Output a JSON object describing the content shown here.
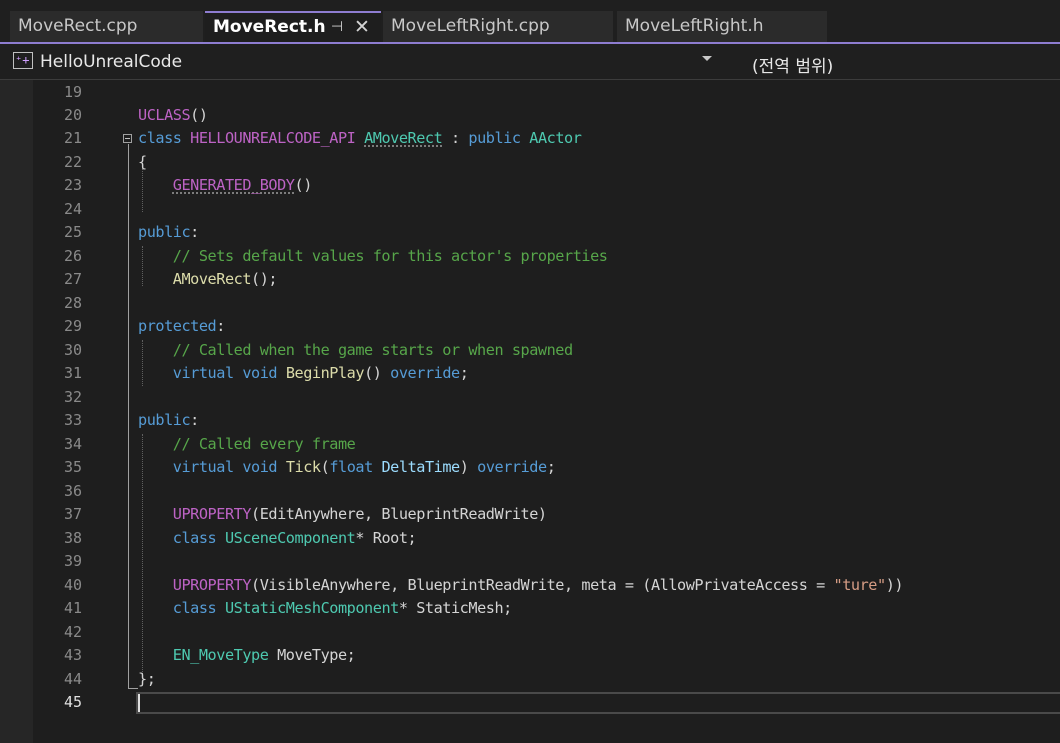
{
  "tabs": [
    {
      "label": "MoveRect.cpp",
      "active": false
    },
    {
      "label": "MoveRect.h",
      "active": true,
      "pin_icon": "pin-icon",
      "close_icon": "close-icon"
    },
    {
      "label": "MoveLeftRight.cpp",
      "active": false
    },
    {
      "label": "MoveLeftRight.h",
      "active": false
    }
  ],
  "navbar": {
    "project": "HelloUnrealCode",
    "project_icon": "cpp-project-icon",
    "scope": "(전역 범위)"
  },
  "editor": {
    "current_line": 45,
    "lines": [
      {
        "n": 19,
        "text": ""
      },
      {
        "n": 20,
        "text": "UCLASS()"
      },
      {
        "n": 21,
        "text": "class HELLOUNREALCODE_API AMoveRect : public AActor"
      },
      {
        "n": 22,
        "text": "{"
      },
      {
        "n": 23,
        "text": "    GENERATED_BODY()"
      },
      {
        "n": 24,
        "text": ""
      },
      {
        "n": 25,
        "text": "public:"
      },
      {
        "n": 26,
        "text": "    // Sets default values for this actor's properties"
      },
      {
        "n": 27,
        "text": "    AMoveRect();"
      },
      {
        "n": 28,
        "text": ""
      },
      {
        "n": 29,
        "text": "protected:"
      },
      {
        "n": 30,
        "text": "    // Called when the game starts or when spawned"
      },
      {
        "n": 31,
        "text": "    virtual void BeginPlay() override;"
      },
      {
        "n": 32,
        "text": ""
      },
      {
        "n": 33,
        "text": "public:"
      },
      {
        "n": 34,
        "text": "    // Called every frame"
      },
      {
        "n": 35,
        "text": "    virtual void Tick(float DeltaTime) override;"
      },
      {
        "n": 36,
        "text": ""
      },
      {
        "n": 37,
        "text": "    UPROPERTY(EditAnywhere, BlueprintReadWrite)"
      },
      {
        "n": 38,
        "text": "    class USceneComponent* Root;"
      },
      {
        "n": 39,
        "text": ""
      },
      {
        "n": 40,
        "text": "    UPROPERTY(VisibleAnywhere, BlueprintReadWrite, meta = (AllowPrivateAccess = \"ture\"))"
      },
      {
        "n": 41,
        "text": "    class UStaticMeshComponent* StaticMesh;"
      },
      {
        "n": 42,
        "text": ""
      },
      {
        "n": 43,
        "text": "    EN_MoveType MoveType;"
      },
      {
        "n": 44,
        "text": "};"
      },
      {
        "n": 45,
        "text": ""
      }
    ]
  },
  "colors": {
    "keyword": "#569cd6",
    "type": "#4ec9b0",
    "macro": "#bd63c5",
    "function": "#dcdcaa",
    "parameter": "#9cdcfe",
    "comment": "#57a64a",
    "string": "#d69d85",
    "accent": "#8e7dd1"
  }
}
